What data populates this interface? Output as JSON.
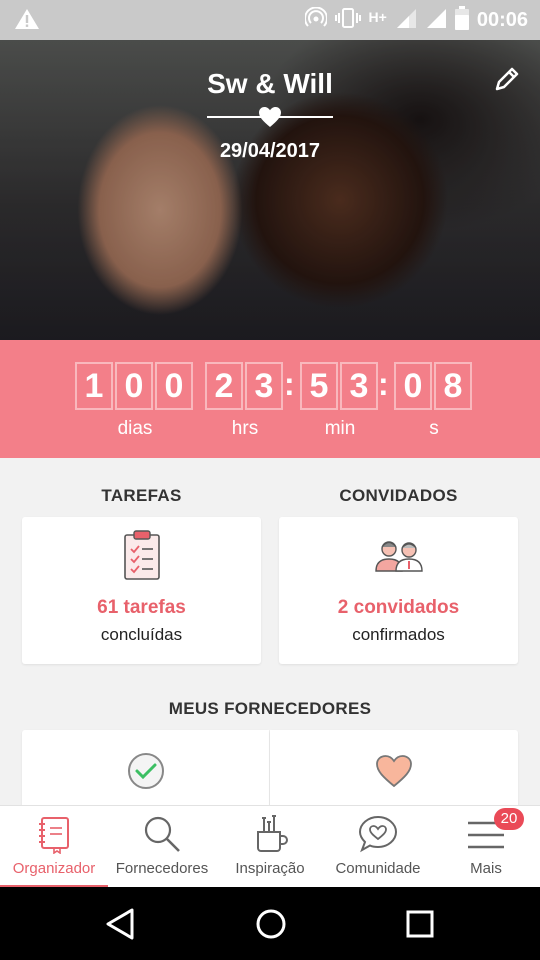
{
  "status_bar": {
    "network": "H+",
    "time": "00:06",
    "icons": [
      "warning-icon",
      "hotspot-icon",
      "vibrate-icon",
      "signal-icon",
      "signal-icon",
      "battery-icon"
    ]
  },
  "hero": {
    "couple_names": "Sw & Will",
    "date": "29/04/2017",
    "edit_icon": "pencil-icon"
  },
  "countdown": {
    "days": [
      "1",
      "0",
      "0"
    ],
    "hours": [
      "2",
      "3"
    ],
    "minutes": [
      "5",
      "3"
    ],
    "seconds": [
      "0",
      "8"
    ],
    "separator": ":",
    "labels": {
      "days": "dias",
      "hours": "hrs",
      "minutes": "min",
      "seconds": "s"
    },
    "accent": "#f37f89"
  },
  "tasks": {
    "title": "TAREFAS",
    "count": "61 tarefas",
    "sub": "concluídas",
    "icon": "clipboard-icon"
  },
  "guests": {
    "title": "CONVIDADOS",
    "count": "2 convidados",
    "sub": "confirmados",
    "icon": "guests-icon"
  },
  "vendors": {
    "title": "MEUS FORNECEDORES",
    "icons": [
      "check-circle-icon",
      "heart-icon"
    ]
  },
  "bottom_nav": {
    "items": [
      {
        "label": "Organizador",
        "icon": "notebook-icon",
        "active": true
      },
      {
        "label": "Fornecedores",
        "icon": "search-icon",
        "active": false
      },
      {
        "label": "Inspiração",
        "icon": "brushes-icon",
        "active": false
      },
      {
        "label": "Comunidade",
        "icon": "chat-heart-icon",
        "active": false
      },
      {
        "label": "Mais",
        "icon": "menu-icon",
        "active": false,
        "badge": "20"
      }
    ]
  },
  "system_nav": [
    "back-icon",
    "home-icon",
    "recents-icon"
  ],
  "colors": {
    "brand": "#e8616b",
    "countdown_bg": "#f37f89",
    "badge": "#ea4a57"
  }
}
